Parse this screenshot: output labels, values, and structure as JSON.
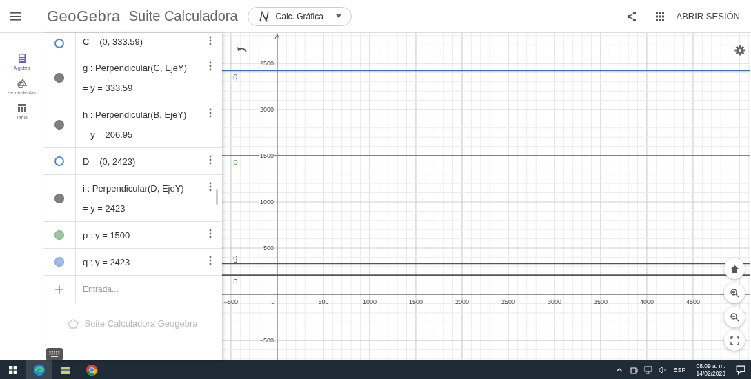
{
  "header": {
    "logo": "GeoGebra",
    "title": "Suite Calculadora",
    "app_switcher": "Calc. Gráfica",
    "sign_in": "ABRIR SESIÓN"
  },
  "nav": [
    {
      "kind": "algebra",
      "label": "Álgebra",
      "selected": true
    },
    {
      "kind": "tools",
      "label": "Herramientas",
      "selected": false
    },
    {
      "kind": "table",
      "label": "Tabla",
      "selected": false
    }
  ],
  "algebra": {
    "rows": [
      {
        "definition": "C = (0, 333.59)",
        "filled": false,
        "color": "#4a86d8"
      },
      {
        "definition": "g : Perpendicular(C, EjeY)",
        "value": "= y = 333.59",
        "filled": true,
        "color": "#808080"
      },
      {
        "definition": "h : Perpendicular(B, EjeY)",
        "value": "= y = 206.95",
        "filled": true,
        "color": "#808080"
      },
      {
        "definition": "D = (0, 2423)",
        "filled": false,
        "color": "#4a86d8"
      },
      {
        "definition": "i : Perpendicular(D, EjeY)",
        "value": "= y = 2423",
        "filled": true,
        "color": "#808080"
      },
      {
        "definition": "p : y = 1500",
        "filled": true,
        "color": "#9cc79c"
      },
      {
        "definition": "q : y = 2423",
        "filled": true,
        "color": "#9dbbe8"
      }
    ],
    "input": {
      "placeholder": "Entrada..."
    },
    "footer": "Suite Calculadora Geogebra"
  },
  "graphics": {
    "chart_data": {
      "type": "line",
      "x": [
        -604,
        5120
      ],
      "series": [
        {
          "name": "q",
          "color": "#3d6fc4",
          "values": [
            2423,
            2423
          ]
        },
        {
          "name": "p",
          "color": "#5a9e5a",
          "values": [
            1500,
            1500
          ]
        },
        {
          "name": "g",
          "color": "#555555",
          "values": [
            334,
            334
          ]
        },
        {
          "name": "h",
          "color": "#555555",
          "values": [
            207,
            207
          ]
        }
      ],
      "grid": true,
      "xlim": [
        -604,
        5120
      ],
      "ylim": [
        -716,
        2828
      ],
      "xticks": [
        {
          "value": -500,
          "label": "−500"
        },
        0,
        500,
        1000,
        1500,
        2000,
        2500,
        3000,
        3500,
        4000,
        4500
      ],
      "yticks": [
        {
          "value": -500,
          "label": "−500"
        },
        500,
        1000,
        1500,
        2000,
        2500
      ]
    }
  },
  "taskbar": {
    "language": "ESP",
    "time": "08:09 a. m.",
    "date": "14/02/2023"
  }
}
